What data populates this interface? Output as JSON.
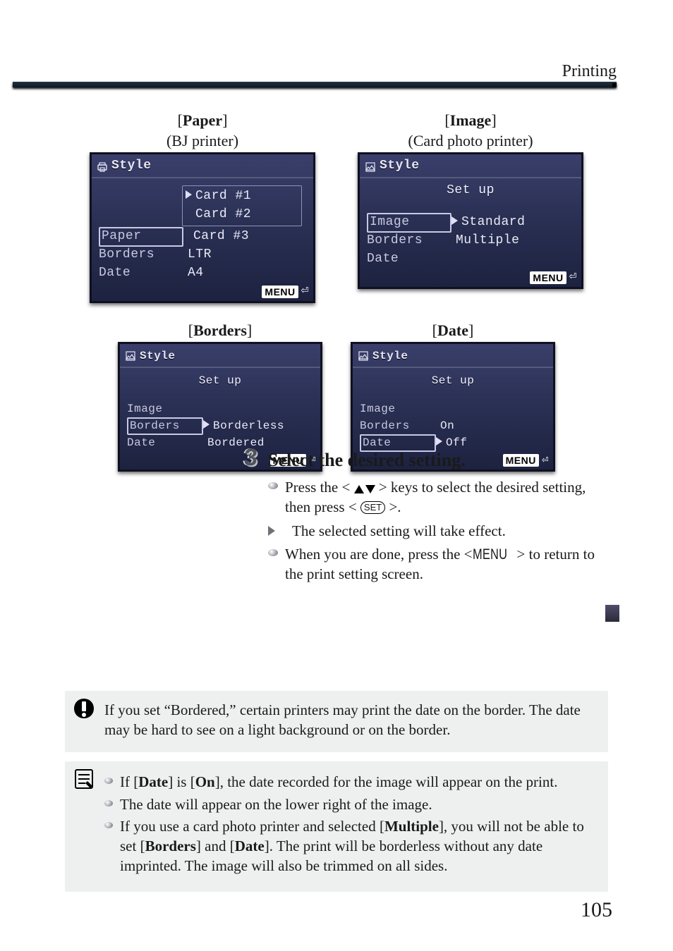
{
  "header": {
    "section": "Printing"
  },
  "screens": {
    "paper": {
      "title_key": "Paper",
      "subtitle": "(BJ printer)",
      "top_label": "Style",
      "menu_left": [
        "Paper",
        "Borders",
        "Date"
      ],
      "options": [
        "Card #1",
        "Card #2",
        "Card #3",
        "LTR",
        "A4"
      ],
      "selected_option_index": 0,
      "menu_word": "MENU"
    },
    "image": {
      "title_key": "Image",
      "subtitle": "(Card photo printer)",
      "top_label": "Style",
      "set_label": "Set up",
      "menu_left": [
        "Image",
        "Borders",
        "Date"
      ],
      "options": [
        "Standard",
        "Multiple"
      ],
      "selected_option_index": 0,
      "menu_word": "MENU"
    },
    "borders": {
      "title_key": "Borders",
      "top_label": "Style",
      "set_label": "Set up",
      "menu_left": [
        "Image",
        "Borders",
        "Date"
      ],
      "options": [
        "Borderless",
        "Bordered"
      ],
      "selected_option_index": 0,
      "menu_word": "MENU"
    },
    "date": {
      "title_key": "Date",
      "top_label": "Style",
      "set_label": "Set up",
      "menu_left": [
        "Image",
        "Borders",
        "Date"
      ],
      "options": [
        "On",
        "Off"
      ],
      "selected_option_index": 1,
      "menu_word": "MENU"
    }
  },
  "step3": {
    "heading": "Select the desired setting.",
    "bullets": {
      "a_pre": "Press the <",
      "a_mid": "> keys to select the desired setting, then press <",
      "a_post": ">.",
      "set_label": "SET",
      "b": "The selected setting will take effect.",
      "c_pre": "When you are done, press the <",
      "c_menu": "MENU",
      "c_post": "> to return to the print setting screen."
    }
  },
  "note1": {
    "text": "If you set “Bordered,” certain printers may print the date on the border. The date may be hard to see on a light background or on the border."
  },
  "note2": {
    "items": {
      "a_pre": "If [",
      "a_date": "Date",
      "a_mid": "] is [",
      "a_on": "On",
      "a_post": "], the date recorded for the image will appear on the print.",
      "b": "The date will appear on the lower right of the image.",
      "c_pre": "If you use a card photo printer and selected [",
      "c_mult": "Multiple",
      "c_mid": "], you will not be able to set [",
      "c_borders": "Borders",
      "c_and": "] and [",
      "c_date": "Date",
      "c_post": "]. The print will be borderless without any date imprinted. The image will also be trimmed on all sides."
    }
  },
  "page_number": "105"
}
